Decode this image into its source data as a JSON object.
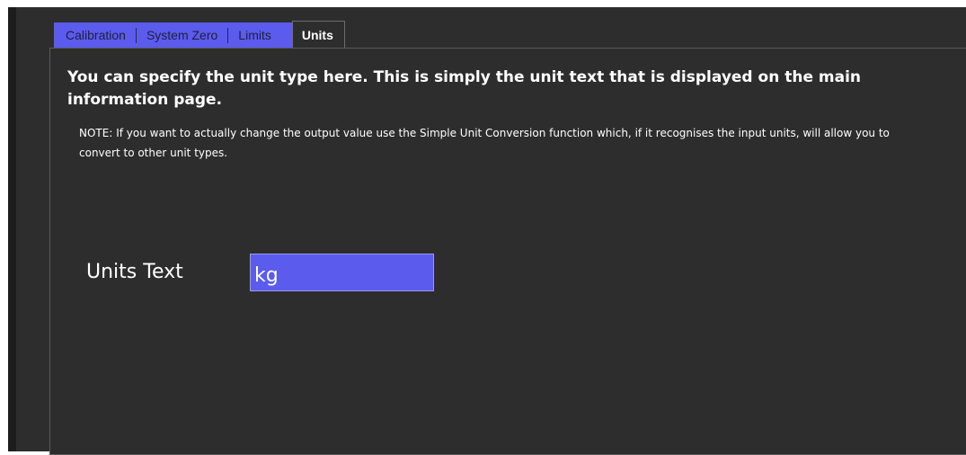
{
  "tabs": {
    "calibration": "Calibration",
    "system_zero": "System Zero",
    "limits": "Limits",
    "units": "Units"
  },
  "active_tab": "Units",
  "content": {
    "heading": "You can specify the unit type here. This is simply the unit text that is displayed on the main information page.",
    "note": "NOTE: If you want to actually change the output value use the Simple Unit Conversion function which, if it recognises the input units, will allow you to convert to other unit types."
  },
  "units_field": {
    "label": "Units Text",
    "value": "kg"
  },
  "colors": {
    "background": "#2d2d2d",
    "tab_inactive_bg": "#5b5bee",
    "input_bg": "#5b5bee",
    "text": "#ffffff"
  }
}
